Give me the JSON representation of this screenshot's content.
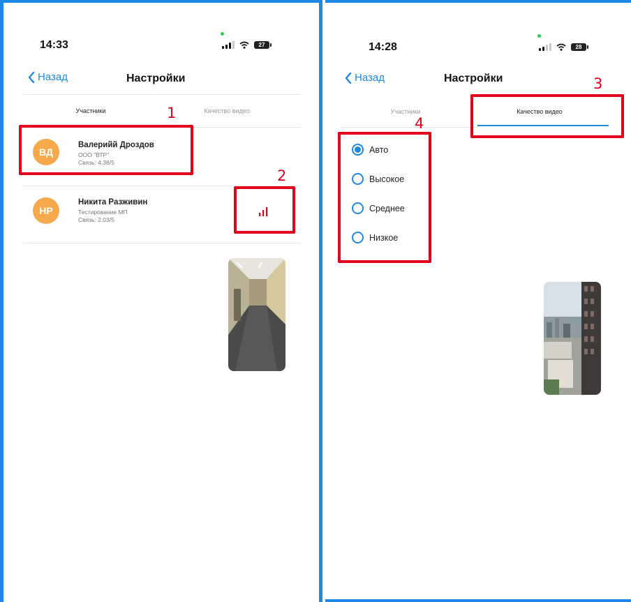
{
  "left_screen": {
    "status_bar": {
      "time": "14:33",
      "battery": "27"
    },
    "nav": {
      "back_label": "Назад",
      "title": "Настройки"
    },
    "tabs": [
      {
        "label": "Участники",
        "active": true
      },
      {
        "label": "Качество видео",
        "active": false
      }
    ],
    "participants": [
      {
        "initials": "ВД",
        "name": "Валерийй Дроздов",
        "org": "ООО \"ВТР\"",
        "connection": "Связь: 4.38/5",
        "avatar_color": "#f5a94a"
      },
      {
        "initials": "НР",
        "name": "Никита Разживин",
        "org": "Тестирование МП",
        "connection": "Связь: 2.03/5",
        "avatar_color": "#f5a94a",
        "signal_level": 0.5,
        "signal_color": "#e3001b"
      }
    ],
    "annotations": [
      "1",
      "2"
    ]
  },
  "right_screen": {
    "status_bar": {
      "time": "14:28",
      "battery": "28"
    },
    "nav": {
      "back_label": "Назад",
      "title": "Настройки"
    },
    "tabs": [
      {
        "label": "Участники",
        "active": false
      },
      {
        "label": "Качество видео",
        "active": true
      }
    ],
    "quality_options": [
      {
        "label": "Авто",
        "selected": true
      },
      {
        "label": "Высокое",
        "selected": false
      },
      {
        "label": "Среднее",
        "selected": false
      },
      {
        "label": "Низкое",
        "selected": false
      }
    ],
    "annotations": [
      "3",
      "4"
    ]
  },
  "colors": {
    "accent": "#1e88e5",
    "annotation_red": "#e3001b",
    "avatar": "#f5a94a"
  }
}
